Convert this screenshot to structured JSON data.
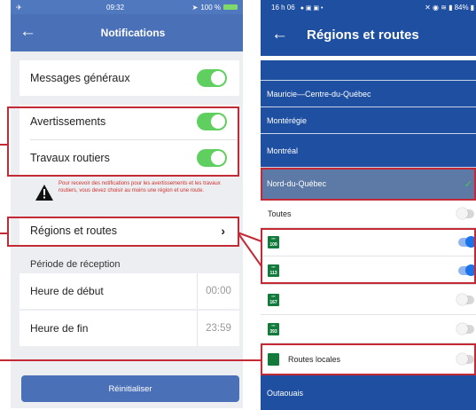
{
  "left_screen": {
    "status_bar": {
      "time": "09:32",
      "battery": "100 %"
    },
    "title": "Notifications",
    "toggles": [
      {
        "label": "Messages généraux",
        "state": "on"
      },
      {
        "label": "Avertissements",
        "state": "on"
      },
      {
        "label": "Travaux routiers",
        "state": "on"
      }
    ],
    "warning_text": "Pour recevoir des notifications pour les avertissements et les travaux routiers, vous devez choisir au moins une région et une route.",
    "regions_label": "Régions et routes",
    "period_header": "Période de réception",
    "start_time": {
      "label": "Heure de début",
      "value": "00:00"
    },
    "end_time": {
      "label": "Heure de fin",
      "value": "23:59"
    },
    "reset_label": "Réinitialiser"
  },
  "right_screen": {
    "status_bar": {
      "time": "16 h 06",
      "battery": "84%"
    },
    "title": "Régions et routes",
    "regions_before": [
      "Mauricie—Centre-du-Québec",
      "Montérégie",
      "Montréal"
    ],
    "selected_region": "Nord-du-Québec",
    "all_label": "Toutes",
    "routes": [
      {
        "number": "109",
        "state": "on"
      },
      {
        "number": "113",
        "state": "on"
      },
      {
        "number": "167",
        "state": "off"
      },
      {
        "number": "393",
        "state": "off"
      }
    ],
    "local_routes_label": "Routes locales",
    "region_after": "Outaouais"
  },
  "colors": {
    "left_appbar": "#4a70b8",
    "right_appbar": "#1e4fa0",
    "toggle_on": "#5fcf5f",
    "highlight": "#c42a35",
    "route_shield": "#127b3c"
  },
  "icons": [
    "back-arrow-icon",
    "warning-icon",
    "chevron-right-icon",
    "check-icon",
    "route-shield-icon"
  ]
}
